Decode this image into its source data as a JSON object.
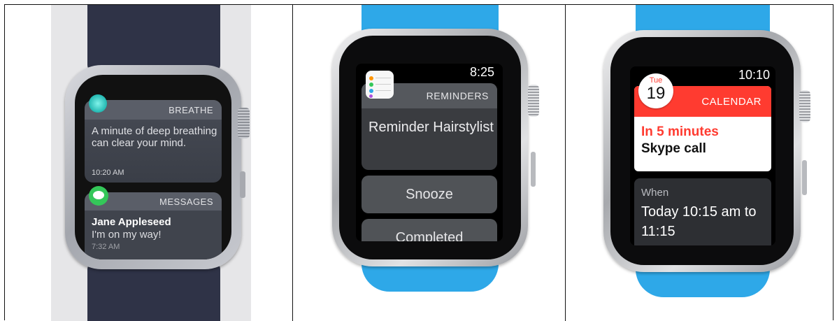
{
  "panel1": {
    "notif_breathe": {
      "app_label": "BREATHE",
      "message": "A minute of deep breathing can clear your mind.",
      "time": "10:20 AM"
    },
    "notif_messages": {
      "app_label": "MESSAGES",
      "sender": "Jane Appleseed",
      "message": "I'm on my way!",
      "time": "7:32 AM"
    }
  },
  "panel2": {
    "time": "8:25",
    "app_label": "REMINDERS",
    "reminder_text": "Reminder Hairstylist",
    "snooze_label": "Snooze",
    "completed_label": "Completed"
  },
  "panel3": {
    "time": "10:10",
    "app_label": "CALENDAR",
    "day_of_week": "Tue",
    "day_number": "19",
    "alert_when": "In 5 minutes",
    "event_title": "Skype call",
    "detail_label": "When",
    "detail_value": "Today 10:15 am to 11:15"
  },
  "colors": {
    "band_navy": "#2f3347",
    "band_blue": "#2ea8e8",
    "calendar_red": "#ff3b30",
    "messages_green": "#34c759",
    "breathe_teal": "#22b7b1"
  }
}
